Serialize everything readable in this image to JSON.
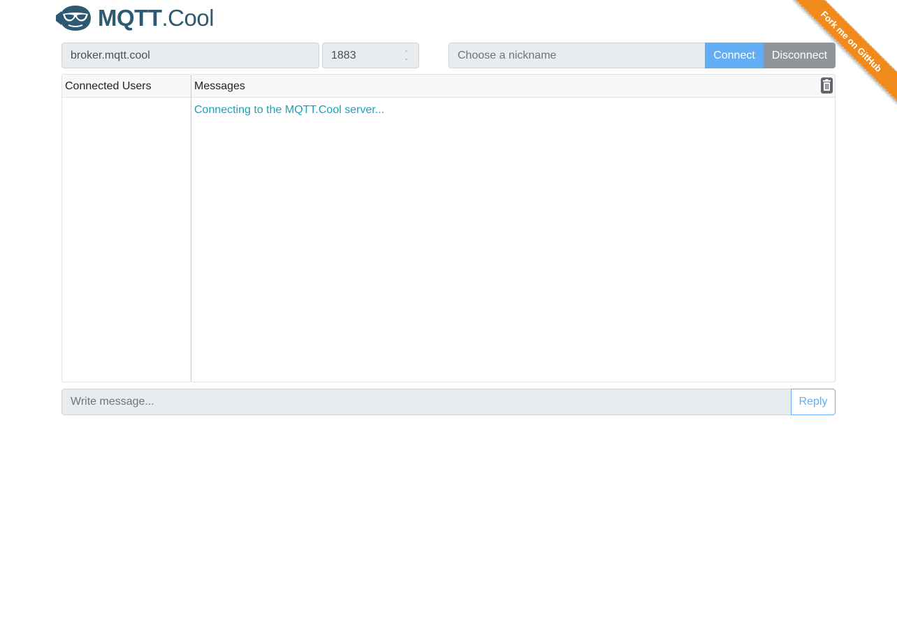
{
  "logo": {
    "text_bold": "MQTT",
    "text_light": ".Cool",
    "icon": "sunglasses-face-icon"
  },
  "ribbon": {
    "label": "Fork me on GitHub",
    "color": "#f08a1c"
  },
  "connection": {
    "broker_value": "broker.mqtt.cool",
    "port_value": "1883",
    "nickname_placeholder": "Choose a nickname",
    "connect_label": "Connect",
    "disconnect_label": "Disconnect"
  },
  "users_panel": {
    "title": "Connected Users",
    "users": []
  },
  "messages_panel": {
    "title": "Messages",
    "clear_icon": "trash-icon",
    "status_message": "Connecting to the MQTT.Cool server..."
  },
  "composer": {
    "placeholder": "Write message...",
    "reply_label": "Reply"
  },
  "colors": {
    "brand": "#2d5a72",
    "primary": "#62aef5",
    "secondary": "#8e959b",
    "info": "#17a2b8"
  }
}
